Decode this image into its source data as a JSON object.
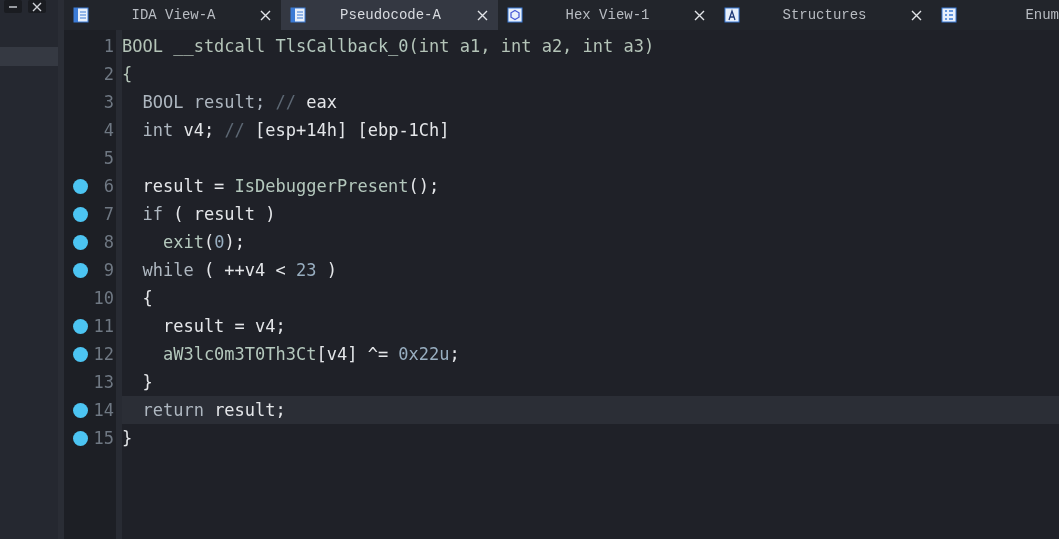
{
  "side_panel": {
    "buttons": [
      {
        "kind": "minimize"
      },
      {
        "kind": "close"
      }
    ]
  },
  "tabs": [
    {
      "label": "IDA View-A",
      "kind": "listing",
      "selected": false
    },
    {
      "label": "Pseudocode-A",
      "kind": "listing",
      "selected": true
    },
    {
      "label": "Hex View-1",
      "kind": "hex",
      "selected": false
    },
    {
      "label": "Structures",
      "kind": "struct",
      "selected": false
    },
    {
      "label": "Enum",
      "kind": "enum",
      "selected": false
    }
  ],
  "code": {
    "lines": [
      {
        "number": "1",
        "breakpoint": false,
        "current": false,
        "tokens": [
          {
            "text": "BOOL __stdcall ",
            "kind": "plain"
          },
          {
            "text": "TlsCallback_0",
            "kind": "func"
          },
          {
            "text": "(int a1, int a2, int a3)",
            "kind": "plain"
          }
        ]
      },
      {
        "number": "2",
        "breakpoint": false,
        "current": false,
        "tokens": [
          {
            "text": "{",
            "kind": "plain"
          }
        ]
      },
      {
        "number": "3",
        "breakpoint": false,
        "current": false,
        "tokens": [
          {
            "text": "  BOOL ",
            "kind": "kw"
          },
          {
            "text": "result;",
            "kind": "kw"
          },
          {
            "text": " // ",
            "kind": "comment"
          },
          {
            "text": "eax",
            "kind": "var"
          }
        ]
      },
      {
        "number": "4",
        "breakpoint": false,
        "current": false,
        "tokens": [
          {
            "text": "  int ",
            "kind": "kw"
          },
          {
            "text": "v4;",
            "kind": "var"
          },
          {
            "text": " // ",
            "kind": "comment"
          },
          {
            "text": "[esp+14h] [ebp-1Ch]",
            "kind": "var"
          }
        ]
      },
      {
        "number": "5",
        "breakpoint": false,
        "current": false
      },
      {
        "number": "6",
        "breakpoint": true,
        "current": false,
        "tokens": [
          {
            "text": "  result = ",
            "kind": "var"
          },
          {
            "text": "IsDebuggerPresent",
            "kind": "func"
          },
          {
            "text": "();",
            "kind": "var"
          }
        ]
      },
      {
        "number": "7",
        "breakpoint": true,
        "current": false,
        "tokens": [
          {
            "text": "  if ",
            "kind": "kw"
          },
          {
            "text": "( result )",
            "kind": "var"
          }
        ]
      },
      {
        "number": "8",
        "breakpoint": true,
        "current": false,
        "tokens": [
          {
            "text": "    exit",
            "kind": "func"
          },
          {
            "text": "(",
            "kind": "var"
          },
          {
            "text": "0",
            "kind": "num"
          },
          {
            "text": ");",
            "kind": "var"
          }
        ]
      },
      {
        "number": "9",
        "breakpoint": true,
        "current": false,
        "tokens": [
          {
            "text": "  while ",
            "kind": "kw"
          },
          {
            "text": "( ++v4 < ",
            "kind": "var"
          },
          {
            "text": "23",
            "kind": "num"
          },
          {
            "text": " )",
            "kind": "var"
          }
        ]
      },
      {
        "number": "10",
        "breakpoint": false,
        "current": false,
        "tokens": [
          {
            "text": "  {",
            "kind": "var"
          }
        ]
      },
      {
        "number": "11",
        "breakpoint": true,
        "current": false,
        "tokens": [
          {
            "text": "    result = v4;",
            "kind": "var"
          }
        ]
      },
      {
        "number": "12",
        "breakpoint": true,
        "current": false,
        "tokens": [
          {
            "text": "    aW3lc0m3T0Th3Ct",
            "kind": "func"
          },
          {
            "text": "[v4] ^= ",
            "kind": "var"
          },
          {
            "text": "0x22u",
            "kind": "num"
          },
          {
            "text": ";",
            "kind": "var"
          }
        ]
      },
      {
        "number": "13",
        "breakpoint": false,
        "current": false,
        "tokens": [
          {
            "text": "  }",
            "kind": "var"
          }
        ]
      },
      {
        "number": "14",
        "breakpoint": true,
        "current": true,
        "tokens": [
          {
            "text": "  return ",
            "kind": "kw"
          },
          {
            "text": "result;",
            "kind": "var"
          }
        ]
      },
      {
        "number": "15",
        "breakpoint": true,
        "current": false,
        "tokens": [
          {
            "text": "}",
            "kind": "var"
          }
        ]
      }
    ]
  }
}
